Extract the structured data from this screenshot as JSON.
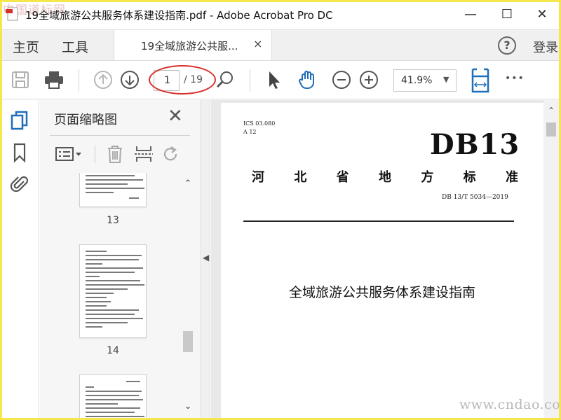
{
  "window": {
    "title": "19全域旅游公共服务体系建设指南.pdf - Adobe Acrobat Pro DC",
    "watermark_top": "中国道标网",
    "minimize": "—",
    "maximize": "☐",
    "close": "✕"
  },
  "menubar": {
    "home": "主页",
    "tools": "工具",
    "tab_label": "19全域旅游公共服...",
    "tab_close": "×",
    "help": "?",
    "login": "登录"
  },
  "toolbar": {
    "page_current": "1",
    "page_total": "/ 19",
    "zoom": "41.9%",
    "zoom_caret": "▼",
    "more": "•••"
  },
  "thumbnails_pane": {
    "title": "页面缩略图",
    "close": "✕",
    "thumbnails": [
      {
        "page": "13"
      },
      {
        "page": "14"
      }
    ]
  },
  "document": {
    "ics": "ICS 03.080",
    "class_code": "A 12",
    "standard_code": "DB13",
    "standard_type": [
      "河",
      "北",
      "省",
      "地",
      "方",
      "标",
      "准"
    ],
    "standard_number": "DB 13/T 5034—2019",
    "title": "全域旅游公共服务体系建设指南"
  },
  "watermark_bottom": "www.cndao.com",
  "colors": {
    "frame": "#f4e64b",
    "accent_blue": "#1f6fb8",
    "highlight_red": "#d9302c"
  }
}
